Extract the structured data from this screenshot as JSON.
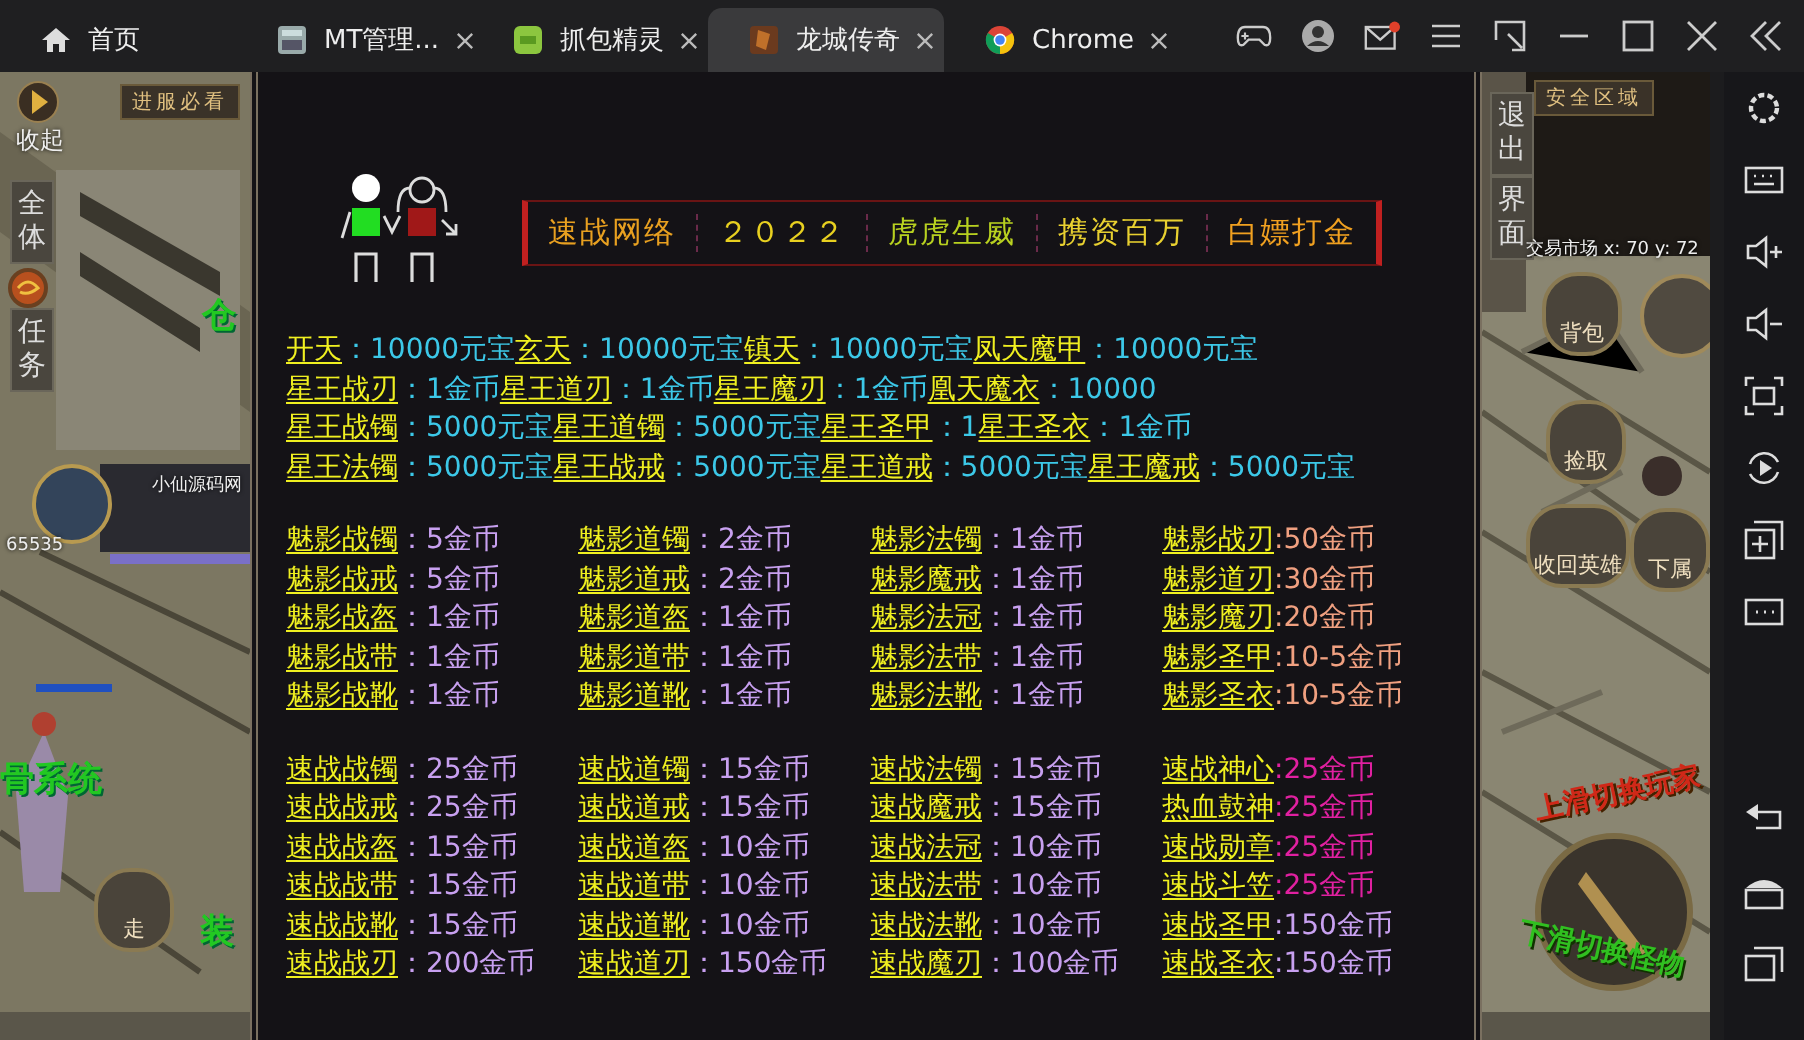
{
  "emulator": {
    "tabs": [
      {
        "label": "首页",
        "kind": "home",
        "selected": false,
        "closable": false
      },
      {
        "label": "MT管理...",
        "kind": "tool",
        "selected": false,
        "closable": true
      },
      {
        "label": "抓包精灵",
        "kind": "app",
        "selected": false,
        "closable": true
      },
      {
        "label": "龙城传奇",
        "kind": "game",
        "selected": true,
        "closable": true
      },
      {
        "label": "Chrome",
        "kind": "browser",
        "selected": false,
        "closable": true
      }
    ],
    "mail_unread": true
  },
  "game": {
    "left_hud": [
      {
        "text": "收起",
        "kind": "caption"
      },
      {
        "text": "进服必看",
        "kind": "tag"
      },
      {
        "text": "全体",
        "kind": "vertical"
      },
      {
        "text": "任务",
        "kind": "vertical"
      },
      {
        "text": "仓",
        "kind": "scene"
      },
      {
        "text": "小仙源码网",
        "kind": "panel"
      },
      {
        "text": "65535",
        "kind": "panel"
      },
      {
        "text": "骨系统",
        "kind": "scene"
      },
      {
        "text": "走",
        "kind": "round"
      },
      {
        "text": "装",
        "kind": "scene"
      }
    ],
    "right_hud": [
      {
        "text": "退出",
        "kind": "vertical"
      },
      {
        "text": "界面",
        "kind": "vertical"
      },
      {
        "text": "安全区域",
        "kind": "tag"
      },
      {
        "text": "交易市场  x: 70  y: 72",
        "kind": "panel"
      },
      {
        "text": "背包",
        "kind": "round"
      },
      {
        "text": "捡取",
        "kind": "round"
      },
      {
        "text": "收回英雄",
        "kind": "round"
      },
      {
        "text": "下属",
        "kind": "round"
      },
      {
        "text": "上滑切换玩家",
        "kind": "swipe-up"
      },
      {
        "text": "下滑切换怪物",
        "kind": "swipe-down"
      }
    ],
    "banner": [
      {
        "text": "速战网络",
        "color": "#e8a020"
      },
      {
        "text": "２０２２",
        "color": "#e8d020"
      },
      {
        "text": "虎虎生威",
        "color": "#b8d020"
      },
      {
        "text": "携资百万",
        "color": "#e8d030"
      },
      {
        "text": "白嫖打金",
        "color": "#f0a020"
      }
    ],
    "price_lines": [
      [
        {
          "name": "开天",
          "value": "：10000元宝",
          "color": "#3cc8e8"
        },
        {
          "name": "玄天",
          "value": "：10000元宝",
          "color": "#3cc8e8"
        },
        {
          "name": "镇天",
          "value": "：10000元宝",
          "color": "#3cc8e8"
        },
        {
          "name": "凤天魔甲",
          "value": "：10000元宝",
          "color": "#3cc8e8"
        }
      ],
      [
        {
          "name": "星王战刃",
          "value": "：1金币",
          "color": "#3cc8e8"
        },
        {
          "name": "星王道刃",
          "value": "：1金币",
          "color": "#3cc8e8"
        },
        {
          "name": "星王魔刃",
          "value": "：1金币",
          "color": "#3cc8e8"
        },
        {
          "name": "凰天魔衣",
          "value": "：10000",
          "color": "#3cc8e8"
        }
      ],
      [
        {
          "name": "星王战镯",
          "value": "：5000元宝",
          "color": "#3cc8e8"
        },
        {
          "name": "星王道镯",
          "value": "：5000元宝",
          "color": "#3cc8e8"
        },
        {
          "name": "星王圣甲",
          "value": "：1",
          "color": "#3cc8e8"
        },
        {
          "name": "星王圣衣",
          "value": "：1金币",
          "color": "#3cc8e8"
        }
      ],
      [
        {
          "name": "星王法镯",
          "value": "：5000元宝",
          "color": "#3cc8e8"
        },
        {
          "name": "星王战戒",
          "value": "：5000元宝",
          "color": "#3cc8e8"
        },
        {
          "name": "星王道戒",
          "value": "：5000元宝",
          "color": "#3cc8e8"
        },
        {
          "name": "星王魔戒",
          "value": "：5000元宝",
          "color": "#3cc8e8"
        }
      ]
    ],
    "price_grids": [
      [
        [
          {
            "name": "魅影战镯",
            "value": "：5金币",
            "color": "#c8a0f0"
          },
          {
            "name": "魅影道镯",
            "value": "：2金币",
            "color": "#c8a0f0"
          },
          {
            "name": "魅影法镯",
            "value": "：1金币",
            "color": "#c8a0f0"
          },
          {
            "name": "魅影战刃",
            "value": ":50金币",
            "color": "#f0a080"
          }
        ],
        [
          {
            "name": "魅影战戒",
            "value": "：5金币",
            "color": "#c8a0f0"
          },
          {
            "name": "魅影道戒",
            "value": "：2金币",
            "color": "#c8a0f0"
          },
          {
            "name": "魅影魔戒",
            "value": "：1金币",
            "color": "#c8a0f0"
          },
          {
            "name": "魅影道刃",
            "value": ":30金币",
            "color": "#f0a080"
          }
        ],
        [
          {
            "name": "魅影战盔",
            "value": "：1金币",
            "color": "#c8a0f0"
          },
          {
            "name": "魅影道盔",
            "value": "：1金币",
            "color": "#c8a0f0"
          },
          {
            "name": "魅影法冠",
            "value": "：1金币",
            "color": "#c8a0f0"
          },
          {
            "name": "魅影魔刃",
            "value": ":20金币",
            "color": "#f0a080"
          }
        ],
        [
          {
            "name": "魅影战带",
            "value": "：1金币",
            "color": "#c8a0f0"
          },
          {
            "name": "魅影道带",
            "value": "：1金币",
            "color": "#c8a0f0"
          },
          {
            "name": "魅影法带",
            "value": "：1金币",
            "color": "#c8a0f0"
          },
          {
            "name": "魅影圣甲",
            "value": ":10-5金币",
            "color": "#f0a080"
          }
        ],
        [
          {
            "name": "魅影战靴",
            "value": "：1金币",
            "color": "#c8a0f0"
          },
          {
            "name": "魅影道靴",
            "value": "：1金币",
            "color": "#c8a0f0"
          },
          {
            "name": "魅影法靴",
            "value": "：1金币",
            "color": "#c8a0f0"
          },
          {
            "name": "魅影圣衣",
            "value": ":10-5金币",
            "color": "#f0a080"
          }
        ]
      ],
      [
        [
          {
            "name": "速战战镯",
            "value": "：25金币",
            "color": "#c8a0f0"
          },
          {
            "name": "速战道镯",
            "value": "：15金币",
            "color": "#c8a0f0"
          },
          {
            "name": "速战法镯",
            "value": "：15金币",
            "color": "#c8a0f0"
          },
          {
            "name": "速战神心",
            "value": ":25金币",
            "color": "#e020a0"
          }
        ],
        [
          {
            "name": "速战战戒",
            "value": "：25金币",
            "color": "#c8a0f0"
          },
          {
            "name": "速战道戒",
            "value": "：15金币",
            "color": "#c8a0f0"
          },
          {
            "name": "速战魔戒",
            "value": "：15金币",
            "color": "#c8a0f0"
          },
          {
            "name": "热血鼓神",
            "value": ":25金币",
            "color": "#e020a0"
          }
        ],
        [
          {
            "name": "速战战盔",
            "value": "：15金币",
            "color": "#c8a0f0"
          },
          {
            "name": "速战道盔",
            "value": "：10金币",
            "color": "#c8a0f0"
          },
          {
            "name": "速战法冠",
            "value": "：10金币",
            "color": "#c8a0f0"
          },
          {
            "name": "速战勋章",
            "value": ":25金币",
            "color": "#e020a0"
          }
        ],
        [
          {
            "name": "速战战带",
            "value": "：15金币",
            "color": "#c8a0f0"
          },
          {
            "name": "速战道带",
            "value": "：10金币",
            "color": "#c8a0f0"
          },
          {
            "name": "速战法带",
            "value": "：10金币",
            "color": "#c8a0f0"
          },
          {
            "name": "速战斗笠",
            "value": ":25金币",
            "color": "#e020a0"
          }
        ],
        [
          {
            "name": "速战战靴",
            "value": "：15金币",
            "color": "#c8a0f0"
          },
          {
            "name": "速战道靴",
            "value": "：10金币",
            "color": "#c8a0f0"
          },
          {
            "name": "速战法靴",
            "value": "：10金币",
            "color": "#c8a0f0"
          },
          {
            "name": "速战圣甲",
            "value": ":150金币",
            "color": "#c8a0f0"
          }
        ],
        [
          {
            "name": "速战战刃",
            "value": "：200金币",
            "color": "#c8a0f0"
          },
          {
            "name": "速战道刃",
            "value": "：150金币",
            "color": "#c8a0f0"
          },
          {
            "name": "速战魔刃",
            "value": "：100金币",
            "color": "#c8a0f0"
          },
          {
            "name": "速战圣衣",
            "value": ":150金币",
            "color": "#c8a0f0"
          }
        ]
      ]
    ]
  }
}
